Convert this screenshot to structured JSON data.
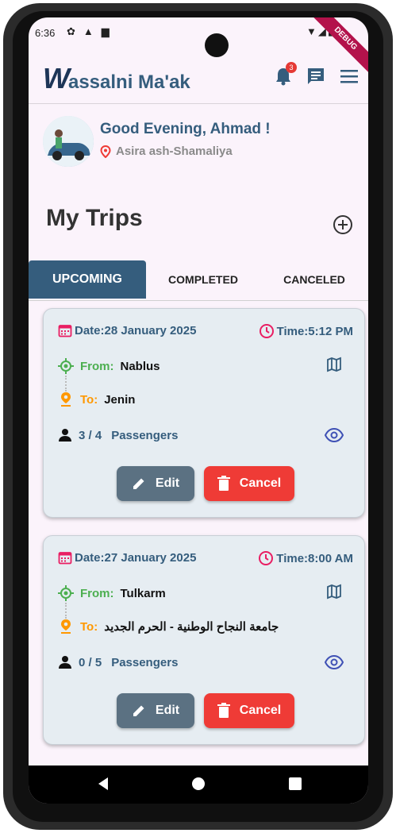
{
  "status_bar": {
    "time": "6:36",
    "debug_banner": "DEBUG"
  },
  "app_bar": {
    "logo_letter": "W",
    "logo_text": "assalni Ma'ak",
    "notification_count": "3"
  },
  "greeting": {
    "title": "Good Evening, Ahmad !",
    "location": "Asira ash-Shamaliya"
  },
  "section": {
    "title": "My Trips"
  },
  "tabs": [
    {
      "label": "UPCOMING"
    },
    {
      "label": "COMPLETED"
    },
    {
      "label": "CANCELED"
    }
  ],
  "trips": [
    {
      "date": "Date:28 January 2025",
      "time": "Time:5:12 PM",
      "from_label": "From:",
      "from": "Nablus",
      "to_label": "To:",
      "to": "Jenin",
      "passengers_count": "3 / 4",
      "passengers_label": "Passengers",
      "edit_label": "Edit",
      "cancel_label": "Cancel"
    },
    {
      "date": "Date:27 January 2025",
      "time": "Time:8:00 AM",
      "from_label": "From:",
      "from": "Tulkarm",
      "to_label": "To:",
      "to": "جامعة النجاح الوطنية - الحرم الجديد",
      "passengers_count": "0 / 5",
      "passengers_label": "Passengers",
      "edit_label": "Edit",
      "cancel_label": "Cancel"
    }
  ],
  "colors": {
    "primary": "#355d7d",
    "cancel": "#ef3b36",
    "edit": "#5b7182",
    "from": "#4caf50",
    "to": "#ff9800",
    "accent_icon": "#e91e63"
  }
}
